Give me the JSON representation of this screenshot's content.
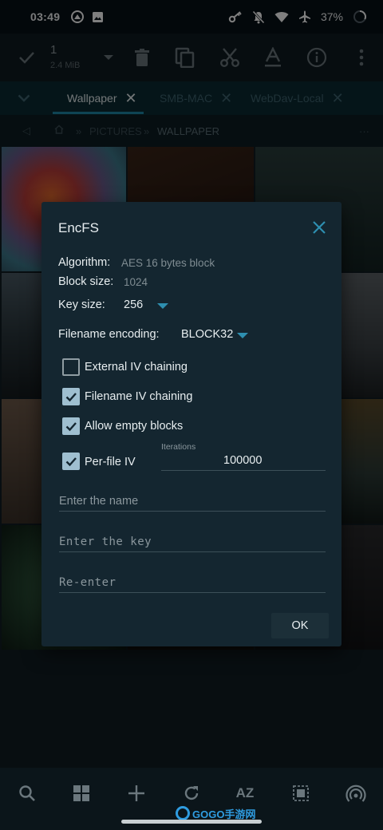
{
  "status_bar": {
    "time": "03:49",
    "battery": "37%"
  },
  "toolbar": {
    "selection_count": "1",
    "selection_size": "2.4 MiB"
  },
  "tabs": [
    {
      "label": "Wallpaper",
      "active": true
    },
    {
      "label": "SMB-MAC",
      "active": false
    },
    {
      "label": "WebDav-Local",
      "active": false
    }
  ],
  "breadcrumb": {
    "sep": "»",
    "items": [
      "PICTURES",
      "WALLPAPER"
    ]
  },
  "dialog": {
    "title": "EncFS",
    "algorithm_label": "Algorithm:",
    "algorithm_value": "AES 16 bytes block",
    "block_size_label": "Block size:",
    "block_size_value": "1024",
    "key_size_label": "Key size:",
    "key_size_value": "256",
    "filename_encoding_label": "Filename encoding:",
    "filename_encoding_value": "BLOCK32",
    "options": [
      {
        "label": "External IV chaining",
        "checked": false
      },
      {
        "label": "Filename IV chaining",
        "checked": true
      },
      {
        "label": "Allow empty blocks",
        "checked": true
      },
      {
        "label": "Per-file IV",
        "checked": true
      }
    ],
    "iterations_label": "Iterations",
    "iterations_value": "100000",
    "name_placeholder": "Enter the name",
    "key_placeholder": "Enter the key",
    "reenter_placeholder": "Re-enter",
    "ok_label": "OK"
  },
  "bottom_bar": {
    "sort_label": "AZ"
  },
  "watermark": {
    "text": "GOGO手游网"
  },
  "colors": {
    "accent": "#2e8fb0",
    "dialog_bg": "#142630",
    "checkbox_on": "#9fbfd0"
  }
}
